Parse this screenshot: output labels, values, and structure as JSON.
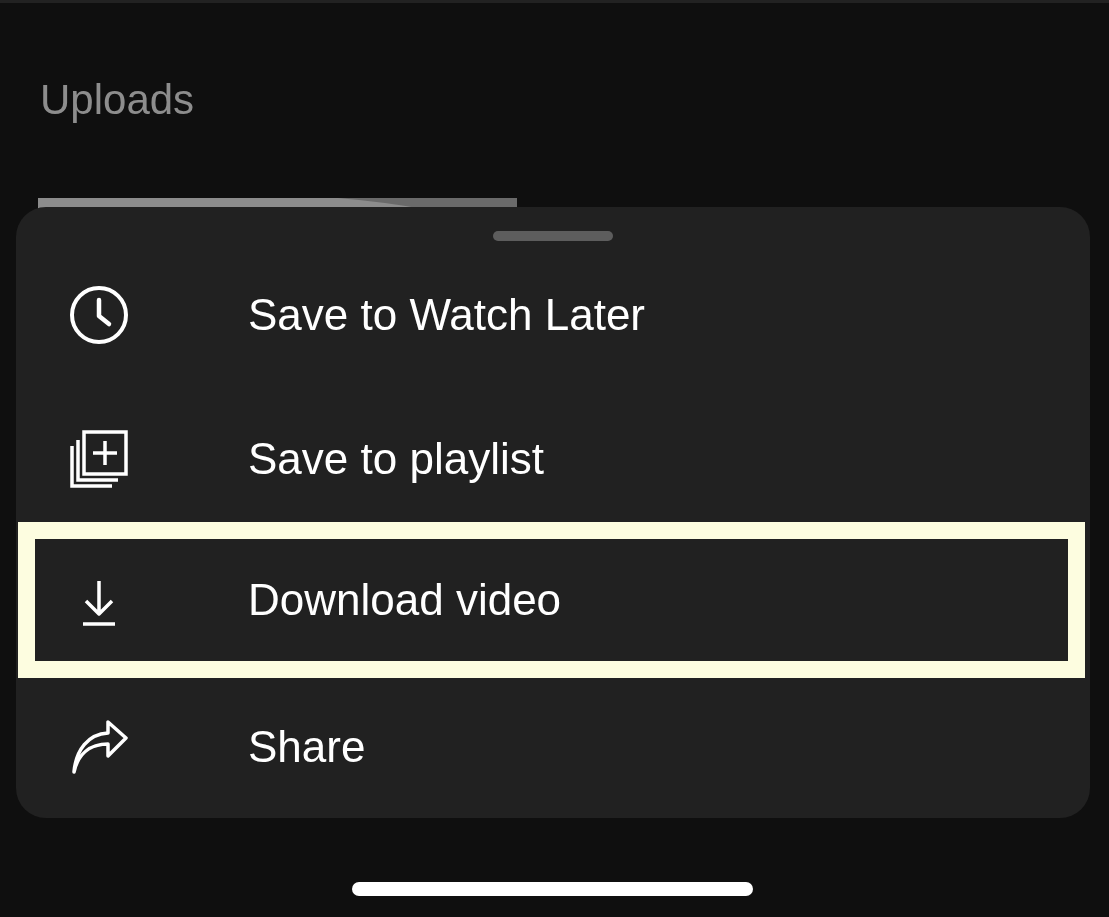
{
  "section": {
    "title": "Uploads"
  },
  "menu": {
    "items": [
      {
        "kind": "clock",
        "label": "Save to Watch Later",
        "highlighted": false
      },
      {
        "kind": "playlist",
        "label": "Save to playlist",
        "highlighted": false
      },
      {
        "kind": "download",
        "label": "Download video",
        "highlighted": true
      },
      {
        "kind": "share",
        "label": "Share",
        "highlighted": false
      }
    ]
  }
}
